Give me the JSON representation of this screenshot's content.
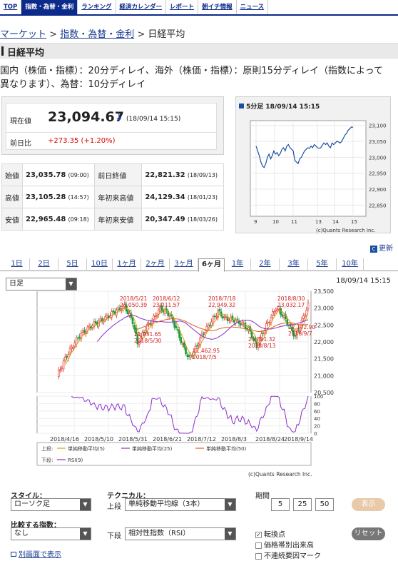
{
  "nav": {
    "items": [
      "TOP",
      "指数・為替・金利",
      "ランキング",
      "経済カレンダー",
      "レポート",
      "朝イチ情報",
      "ニュース"
    ],
    "active_index": 1
  },
  "breadcrumb": {
    "items": [
      "マーケット",
      "指数・為替・金利"
    ],
    "current": "日経平均",
    "separator": ">"
  },
  "page_title": "日経平均",
  "notice": {
    "line1": "国内（株価・指標）：20分ディレイ、海外（株価・指標）：原則15分ディレイ（指数によって",
    "line2": "異なります）、為替：10分ディレイ"
  },
  "current": {
    "label": "現在値",
    "value": "23,094.67",
    "arrow": "↓",
    "time": "(18/09/14 15:15)",
    "change_label": "前日比",
    "change": "+273.35 (+1.20%)"
  },
  "stats": [
    {
      "label": "始値",
      "value": "23,035.78",
      "time": "(09:00)",
      "label2": "前日終値",
      "value2": "22,821.32",
      "time2": "(18/09/13)"
    },
    {
      "label": "高値",
      "value": "23,105.28",
      "time": "(14:57)",
      "label2": "年初来高値",
      "value2": "24,129.34",
      "time2": "(18/01/23)"
    },
    {
      "label": "安値",
      "value": "22,965.48",
      "time": "(09:18)",
      "label2": "年初来安値",
      "value2": "20,347.49",
      "time2": "(18/03/26)"
    }
  ],
  "mini_chart": {
    "title": "5分足 18/09/14 15:15",
    "credit": "(c)Quants Research Inc.",
    "y_ticks": [
      "23,100",
      "23,050",
      "23,000",
      "22,950",
      "22,900",
      "22,850"
    ],
    "x_ticks": [
      "9",
      "10",
      "11",
      "13",
      "14",
      "15"
    ]
  },
  "update_label": "更新",
  "periods": {
    "items": [
      "1日",
      "2日",
      "5日",
      "10日",
      "1ヶ月",
      "2ヶ月",
      "3ヶ月",
      "6ヶ月",
      "1年",
      "2年",
      "3年",
      "5年",
      "10年"
    ],
    "active_index": 7
  },
  "main_chart_header": {
    "timestamp": "18/09/14 15:15",
    "candle_type": "日足"
  },
  "chart_data": {
    "type": "line",
    "title": "",
    "x_tick_labels": [
      "2018/4/16",
      "2018/5/10",
      "2018/5/31",
      "2018/6/21",
      "2018/7/12",
      "2018/8/3",
      "2018/8/24",
      "2018/9/14"
    ],
    "y_ticks": [
      "23,500",
      "23,000",
      "22,500",
      "22,000",
      "21,500",
      "21,000",
      "20,500"
    ],
    "ylim": [
      20500,
      23500
    ],
    "rsi_ticks": [
      "100",
      "80",
      "60",
      "40",
      "20",
      "0"
    ],
    "annotations": [
      {
        "date": "2018/5/21",
        "value": "23,050.39"
      },
      {
        "date": "2018/6/12",
        "value": "23,011.57"
      },
      {
        "date": "2018/7/18",
        "value": "22,949.32"
      },
      {
        "date": "2018/8/30",
        "value": "23,032.17"
      },
      {
        "date": "2018/5/30",
        "value": "21,931.65"
      },
      {
        "date": "2018/7/5",
        "value": "21,462.95"
      },
      {
        "date": "2018/8/13",
        "value": "21,851.32"
      },
      {
        "date": "2018/9/7",
        "value": "22,172.90"
      }
    ],
    "legend": {
      "upper_label": "上段:",
      "lower_label": "下段:",
      "upper": [
        {
          "name": "単純移動平均(5)",
          "color": "#d4a017"
        },
        {
          "name": "単純移動平均(25)",
          "color": "#8b2fc9"
        },
        {
          "name": "単純移動平均(50)",
          "color": "#e06020"
        }
      ],
      "lower": [
        {
          "name": "RSI(9)",
          "color": "#8b2fc9"
        }
      ]
    },
    "credit": "(c)Quants Research Inc."
  },
  "controls": {
    "style_label": "スタイル：",
    "style_value": "ローソク足",
    "compare_label": "比較する指数：",
    "compare_value": "なし",
    "technical_label": "テクニカル：",
    "upper_label": "上段",
    "upper_value": "単純移動平均線（3本）",
    "lower_label": "下段",
    "lower_value": "相対性指数（RSI）",
    "period_label": "期間",
    "periods": [
      "5",
      "25",
      "50"
    ],
    "show_button": "表示",
    "reset_button": "リセット",
    "checks": [
      {
        "label": "転換点",
        "checked": true
      },
      {
        "label": "価格帯別出来高",
        "checked": false
      },
      {
        "label": "不連続要因マーク",
        "checked": false
      }
    ],
    "other_window": "別画面で表示"
  },
  "colors": {
    "nav": "#0b2a8a",
    "up_candle": "#e0302a",
    "down_candle": "#1a9a3a",
    "change_positive": "#dd0000",
    "link": "#1a3c8f"
  }
}
